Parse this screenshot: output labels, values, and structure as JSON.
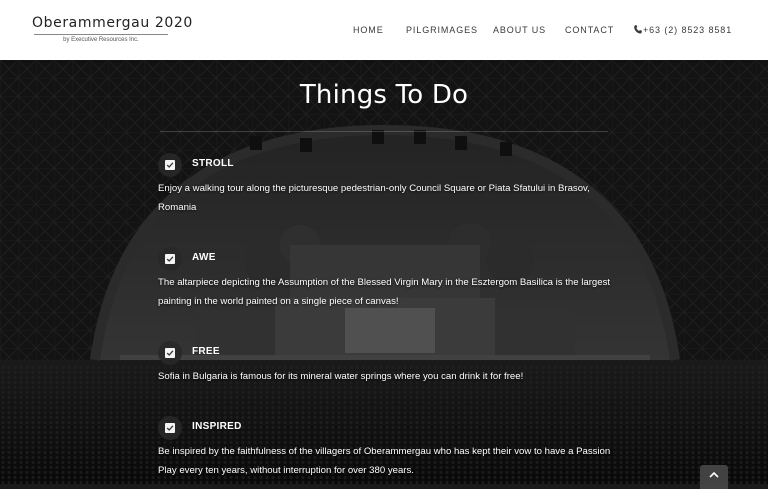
{
  "brand": {
    "title": "Oberammergau 2020",
    "subtitle": "by Executive Resources Inc."
  },
  "nav": {
    "items": [
      {
        "label": "HOME"
      },
      {
        "label": "PILGRIMAGES"
      },
      {
        "label": "ABOUT US"
      },
      {
        "label": "CONTACT"
      }
    ],
    "phone": "+63 (2) 8523 8581",
    "phone_icon": "phone-icon"
  },
  "main": {
    "title": "Things To Do",
    "items": [
      {
        "label": "STROLL",
        "icon": "checkbox-icon",
        "text": "Enjoy a walking tour along the picturesque pedestrian-only Council Square or Piata Sfatului in Brasov, Romania"
      },
      {
        "label": "AWE",
        "icon": "checkbox-icon",
        "text": "The altarpiece depicting the Assumption of the Blessed Virgin Mary in the Esztergom Basilica is the largest painting in the world painted on a single piece of canvas!"
      },
      {
        "label": "FREE",
        "icon": "checkbox-icon",
        "text": "Sofia in Bulgaria is famous for its mineral water springs where you can drink it for free!"
      },
      {
        "label": "INSPIRED",
        "icon": "checkbox-icon",
        "text": "Be inspired by the faithfulness of the villagers of Oberammergau who has kept their vow to have a Passion Play every ten years, without interruption for over 380 years."
      }
    ]
  },
  "scroll_top_icon": "chevron-up-icon",
  "colors": {
    "header_bg": "#ffffff",
    "overlay": "#000000",
    "text": "#ffffff"
  }
}
